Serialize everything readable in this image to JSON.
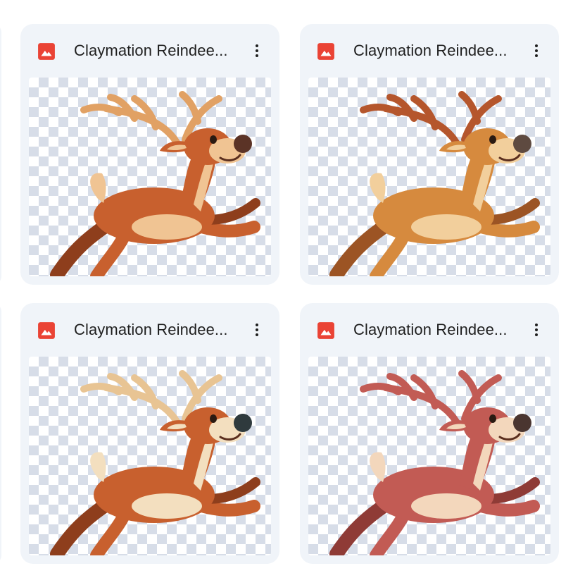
{
  "files": [
    {
      "name": "Claymation Reindee...",
      "type_icon": "image-file-icon",
      "colors": {
        "body": "#c8602e",
        "antler": "#e1a164",
        "belly": "#f0c493",
        "nose": "#5b3326",
        "dark": "#8e3e1c"
      }
    },
    {
      "name": "Claymation Reindee...",
      "type_icon": "image-file-icon",
      "colors": {
        "body": "#d68a3e",
        "antler": "#b5562c",
        "belly": "#f2cf9c",
        "nose": "#5e4a40",
        "dark": "#9c5424"
      }
    },
    {
      "name": "Claymation Reindee...",
      "type_icon": "image-file-icon",
      "colors": {
        "body": "#c8602e",
        "antler": "#e8c493",
        "belly": "#f3dfbf",
        "nose": "#2f3a3d",
        "dark": "#8e3e1c"
      }
    },
    {
      "name": "Claymation Reindee...",
      "type_icon": "image-file-icon",
      "colors": {
        "body": "#c25b54",
        "antler": "#c25b54",
        "belly": "#f3d7bc",
        "nose": "#4a3530",
        "dark": "#8f3b36"
      }
    }
  ],
  "more_icon": "more-vert-icon",
  "accent": {
    "icon_red": "#ea4335",
    "card_bg": "#f0f4f9",
    "text": "#1f1f1f"
  }
}
